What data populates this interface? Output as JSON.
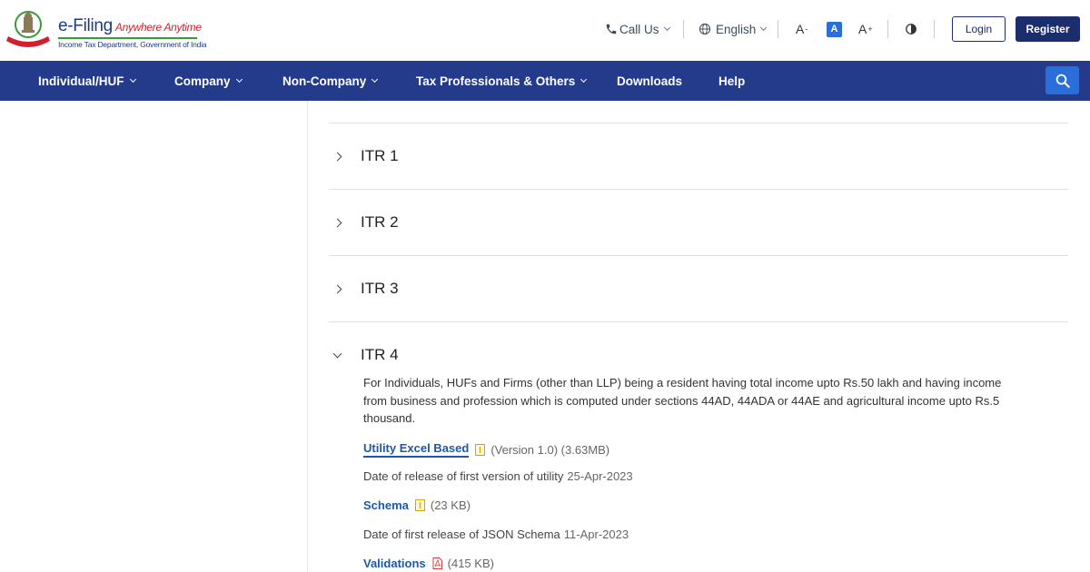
{
  "header": {
    "brand_title": "e-Filing",
    "brand_tagline": "Anywhere Anytime",
    "brand_subtitle": "Income Tax Department, Government of India",
    "call_us": "Call Us",
    "language": "English",
    "font_decrease": "A",
    "font_default": "A",
    "font_increase": "A",
    "login_label": "Login",
    "register_label": "Register"
  },
  "nav": {
    "items": [
      {
        "label": "Individual/HUF",
        "has_dropdown": true
      },
      {
        "label": "Company",
        "has_dropdown": true
      },
      {
        "label": "Non-Company",
        "has_dropdown": true
      },
      {
        "label": "Tax Professionals & Others",
        "has_dropdown": true
      },
      {
        "label": "Downloads",
        "has_dropdown": false
      },
      {
        "label": "Help",
        "has_dropdown": false
      }
    ]
  },
  "accordion": {
    "items": [
      {
        "title": "ITR 1",
        "expanded": false
      },
      {
        "title": "ITR 2",
        "expanded": false
      },
      {
        "title": "ITR 3",
        "expanded": false
      },
      {
        "title": "ITR 4",
        "expanded": true
      }
    ],
    "itr4": {
      "description": "For Individuals, HUFs and Firms (other than LLP) being a resident having total income upto Rs.50 lakh and having income from business and profession which is computed under sections 44AD, 44ADA or 44AE and agricultural income upto Rs.5 thousand.",
      "utility_link": "Utility Excel Based",
      "utility_meta": "(Version 1.0) (3.63MB)",
      "utility_release_label": "Date of release of first version of utility",
      "utility_release_date": "25-Apr-2023",
      "schema_link": "Schema",
      "schema_meta": "(23 KB)",
      "schema_release_label": "Date of first release of JSON Schema",
      "schema_release_date": "11-Apr-2023",
      "validations_link": "Validations",
      "validations_meta": "(415 KB)"
    }
  },
  "colors": {
    "navbar": "#243a8b",
    "primary": "#1c2d6e",
    "link": "#1c5aa6",
    "search": "#2a6edb"
  }
}
